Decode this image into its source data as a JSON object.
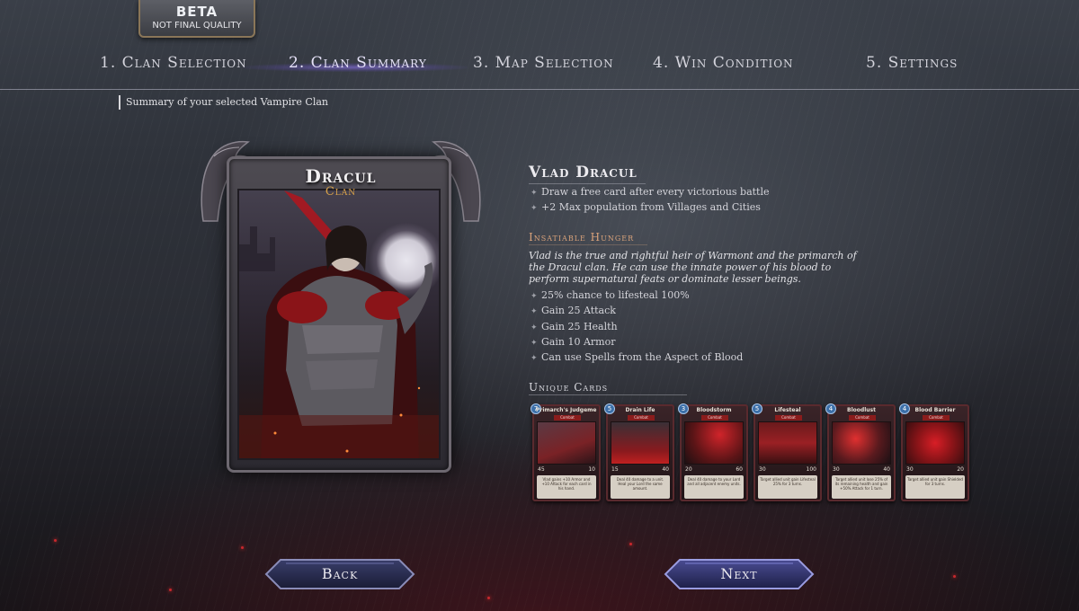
{
  "beta_badge": {
    "line1": "BETA",
    "line2": "NOT FINAL QUALITY"
  },
  "steps": [
    {
      "label": "1. Clan Selection",
      "active": false
    },
    {
      "label": "2. Clan Summary",
      "active": true
    },
    {
      "label": "3. Map Selection",
      "active": false
    },
    {
      "label": "4. Win Condition",
      "active": false
    },
    {
      "label": "5. Settings",
      "active": false
    }
  ],
  "subtitle": "Summary of your selected Vampire Clan",
  "clan": {
    "name": "Dracul",
    "label": "Clan"
  },
  "hero": {
    "name": "Vlad Dracul",
    "traits": [
      "Draw a free card after every victorious battle",
      "+2 Max population from Villages and Cities"
    ]
  },
  "ability": {
    "name": "Insatiable Hunger",
    "description": "Vlad is the true and rightful heir of Warmont and the primarch of the Dracul clan. He can use the innate power of his blood to perform supernatural feats or dominate lesser beings.",
    "effects": [
      "25% chance to lifesteal 100%",
      "Gain 25 Attack",
      "Gain 25 Health",
      "Gain 10 Armor",
      "Can use Spells from the Aspect of  Blood"
    ]
  },
  "unique_cards": {
    "title": "Unique Cards",
    "cards": [
      {
        "name": "Primarch's Judgement",
        "type": "Combat",
        "cost": "7",
        "attack": "45",
        "health": "10",
        "text": "Vlad gains +10 Armor and +10 Attack for each card in his hand."
      },
      {
        "name": "Drain Life",
        "type": "Combat",
        "cost": "5",
        "attack": "15",
        "health": "40",
        "text": "Deal 40 damage to a unit. Heal your Lord the same amount."
      },
      {
        "name": "Bloodstorm",
        "type": "Combat",
        "cost": "3",
        "attack": "20",
        "health": "60",
        "text": "Deal 40 damage to your Lord and all adjacent enemy units."
      },
      {
        "name": "Lifesteal",
        "type": "Combat",
        "cost": "5",
        "attack": "30",
        "health": "100",
        "text": "Target allied unit gain Lifesteal 25% for 3 turns."
      },
      {
        "name": "Bloodlust",
        "type": "Combat",
        "cost": "4",
        "attack": "30",
        "health": "40",
        "text": "Target allied unit lose 25% of its remaining health and gain +50% Attack for 1 turn."
      },
      {
        "name": "Blood Barrier",
        "type": "Combat",
        "cost": "4",
        "attack": "30",
        "health": "20",
        "text": "Target allied unit gain Shielded for 3 turns."
      }
    ]
  },
  "buttons": {
    "back": "Back",
    "next": "Next"
  },
  "colors": {
    "accent_gold": "#d8a24a",
    "ability_title": "#d9a27a",
    "active_step_glow": "#9678ff",
    "card_border": "#5a2a2e",
    "ember_red": "#c8282d"
  }
}
